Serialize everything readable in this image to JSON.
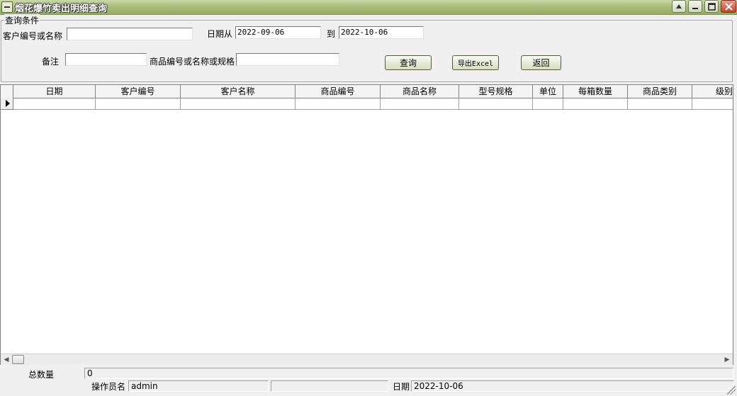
{
  "window": {
    "title": "烟花爆竹卖出明细查询",
    "buttons": [
      "up-arrow-icon",
      "minimize-icon",
      "maximize-icon",
      "close-icon"
    ]
  },
  "query": {
    "group_label": "查询条件",
    "customer_label": "客户编号或名称",
    "customer_value": "",
    "date_from_label": "日期从",
    "date_from": "2022-09-06",
    "date_to_label": "到",
    "date_to": "2022-10-06",
    "remark_label": "备注",
    "remark_value": "",
    "product_label": "商品编号或名称或规格",
    "product_value": "",
    "search_button": "查询",
    "export_button": "导出Excel",
    "back_button": "返回"
  },
  "grid": {
    "columns": [
      "日期",
      "客户编号",
      "客户名称",
      "商品编号",
      "商品名称",
      "型号规格",
      "单位",
      "每箱数量",
      "商品类别",
      "级别"
    ],
    "rows": [
      [
        "",
        "",
        "",
        "",
        "",
        "",
        "",
        "",
        "",
        ""
      ]
    ]
  },
  "status": {
    "total_label": "总数量",
    "total_value": "0",
    "operator_label": "操作员名",
    "operator_value": "admin",
    "date_label": "日期",
    "date_value": "2022-10-06"
  },
  "colors": {
    "titlebar": "#a9bf7b",
    "background": "#f0f0f0",
    "button_border": "#4f5d3a"
  }
}
